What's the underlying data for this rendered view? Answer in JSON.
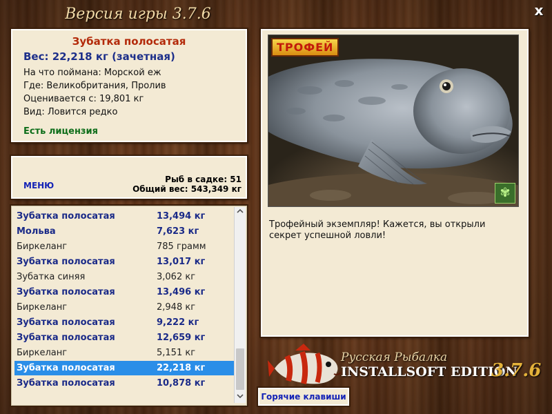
{
  "window": {
    "title": "Версия игры 3.7.6",
    "close_label": "x"
  },
  "info": {
    "fish_name": "Зубатка полосатая",
    "weight": "Вес: 22,218 кг (зачетная)",
    "caught_on": "На что поймана: Морской еж",
    "where": "Где: Великобритания, Пролив",
    "rated_from": "Оценивается с: 19,801 кг",
    "kind": "Вид: Ловится редко",
    "license": "Есть лицензия"
  },
  "stats": {
    "menu_label": "МЕНЮ",
    "fish_in_net": "Рыб в садке: 51",
    "total_weight": "Общий вес: 543,349 кг"
  },
  "catch_list": [
    {
      "name": "Зубатка полосатая",
      "weight": "13,494 кг",
      "bold": true,
      "selected": false
    },
    {
      "name": "Мольва",
      "weight": "7,623 кг",
      "bold": true,
      "selected": false
    },
    {
      "name": "Биркеланг",
      "weight": "785 грамм",
      "bold": false,
      "selected": false
    },
    {
      "name": "Зубатка полосатая",
      "weight": "13,017 кг",
      "bold": true,
      "selected": false
    },
    {
      "name": "Зубатка синяя",
      "weight": "3,062 кг",
      "bold": false,
      "selected": false
    },
    {
      "name": "Зубатка полосатая",
      "weight": "13,496 кг",
      "bold": true,
      "selected": false
    },
    {
      "name": "Биркеланг",
      "weight": "2,948 кг",
      "bold": false,
      "selected": false
    },
    {
      "name": "Зубатка полосатая",
      "weight": "9,222 кг",
      "bold": true,
      "selected": false
    },
    {
      "name": "Зубатка полосатая",
      "weight": "12,659 кг",
      "bold": true,
      "selected": false
    },
    {
      "name": "Биркеланг",
      "weight": "5,151 кг",
      "bold": false,
      "selected": false
    },
    {
      "name": "Зубатка полосатая",
      "weight": "22,218 кг",
      "bold": true,
      "selected": true
    },
    {
      "name": "Зубатка полосатая",
      "weight": "10,878 кг",
      "bold": true,
      "selected": false
    }
  ],
  "trophy": {
    "badge": "ТРОФЕЙ",
    "caption": "Трофейный экземпляр! Кажется, вы открыли секрет успешной ловли!"
  },
  "brand": {
    "line1": "Русская Рыбалка",
    "line2": "INSTALLSOFT EDITION",
    "version": "3.7.6"
  },
  "hotkeys_label": "Горячие клавиши",
  "icons": {
    "close": "close-icon",
    "butterfly": "butterfly-icon",
    "scroll_up": "chevron-up-icon",
    "scroll_down": "chevron-down-icon"
  },
  "colors": {
    "panel_bg": "#f3ead4",
    "selection": "#2a8ee8",
    "fish_name_red": "#b32a0a",
    "link_blue": "#1322b6",
    "license_green": "#0e6e1a"
  }
}
